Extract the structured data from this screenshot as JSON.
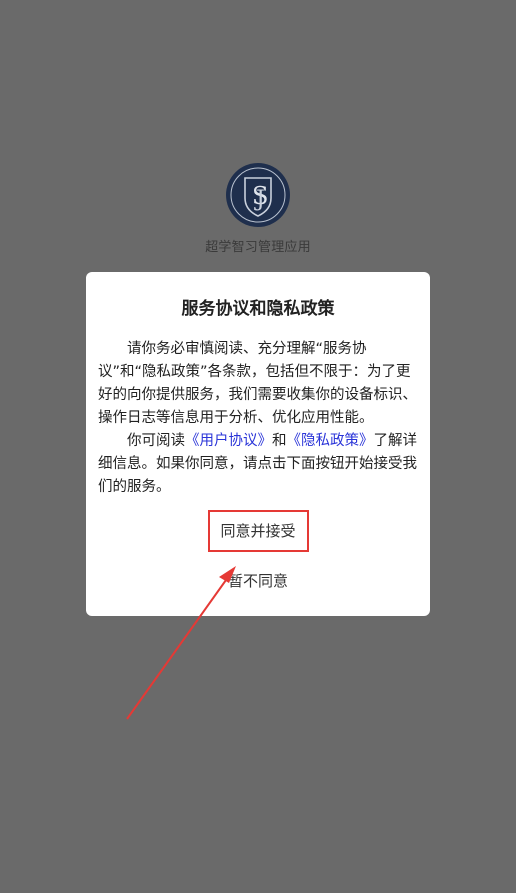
{
  "app": {
    "name": "超学智习管理应用",
    "logo_icon": "shield-monogram-logo-icon",
    "logo_color": "#1f2f4d"
  },
  "dialog": {
    "title": "服务协议和隐私政策",
    "para1": "请你务必审慎阅读、充分理解“服务协议”和“隐私政策”各条款，包括但不限于：为了更好的向你提供服务，我们需要收集你的设备标识、操作日志等信息用于分析、优化应用性能。",
    "para2_prefix": "你可阅读",
    "user_agreement_link": "《用户协议》",
    "and_text": "和",
    "privacy_link": "《隐私政策》",
    "para2_suffix": "了解详细信息。如果你同意，请点击下面按钮开始接受我们的服务。",
    "accept_label": "同意并接受",
    "decline_label": "暂不同意",
    "link_color": "#2a34d8"
  },
  "annotation": {
    "highlight_color": "#e53935"
  },
  "colors": {
    "overlay_bg": "#6a6a6a",
    "dialog_bg": "#ffffff"
  }
}
